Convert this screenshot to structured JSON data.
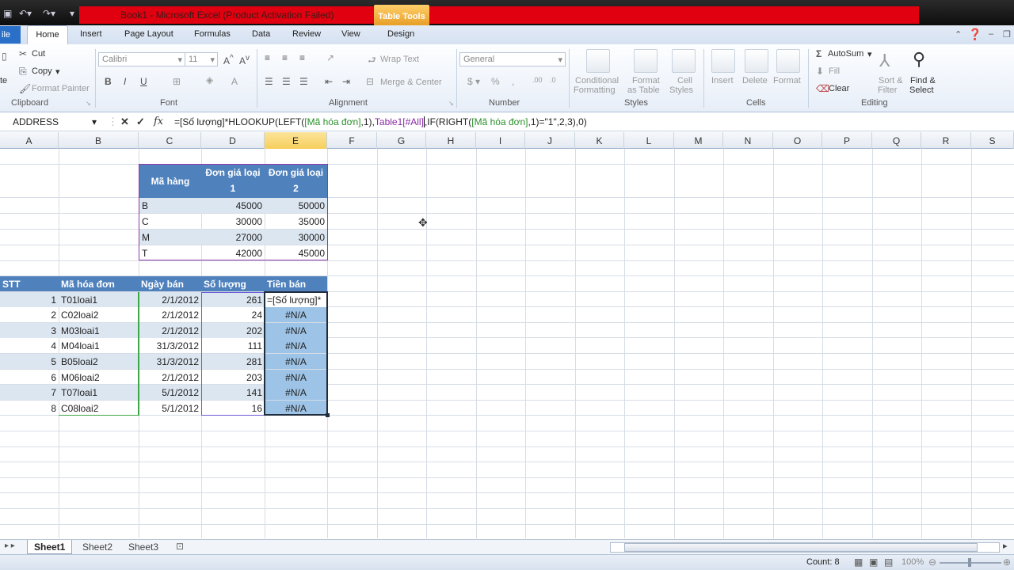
{
  "window": {
    "title": "Book1  -  Microsoft Excel (Product Activation Failed)",
    "contextual_tab_group": "Table Tools"
  },
  "ribbon_tabs": {
    "file": "ile",
    "home": "Home",
    "insert": "Insert",
    "page_layout": "Page Layout",
    "formulas": "Formulas",
    "data": "Data",
    "review": "Review",
    "view": "View",
    "design": "Design"
  },
  "clipboard": {
    "paste": "te",
    "cut": "Cut",
    "copy": "Copy",
    "format_painter": "Format Painter",
    "label": "Clipboard"
  },
  "font": {
    "name": "Calibri",
    "size": "11",
    "label": "Font"
  },
  "alignment": {
    "wrap_text": "Wrap Text",
    "merge_center": "Merge & Center",
    "label": "Alignment"
  },
  "number": {
    "format": "General",
    "label": "Number"
  },
  "styles": {
    "conditional_1": "Conditional",
    "conditional_2": "Formatting",
    "format_table_1": "Format",
    "format_table_2": "as Table",
    "cell_styles_1": "Cell",
    "cell_styles_2": "Styles",
    "label": "Styles"
  },
  "cells": {
    "insert": "Insert",
    "delete": "Delete",
    "format": "Format",
    "label": "Cells"
  },
  "editing": {
    "autosum": "AutoSum",
    "fill": "Fill",
    "clear": "Clear",
    "sort_1": "Sort &",
    "sort_2": "Filter",
    "find_1": "Find &",
    "find_2": "Select",
    "label": "Editing"
  },
  "formula_bar": {
    "name_box": "ADDRESS",
    "fx": "fx",
    "formula_part1": "=[Số lượng]*HLOOKUP(LEFT(",
    "formula_part2": "[Mã hóa đơn]",
    "formula_part3": ",1),",
    "formula_part4": "Table1[#All]",
    "formula_part5": ",IF(RIGHT(",
    "formula_part6": "[Mã hóa đơn]",
    "formula_part7": ",1)=\"1\",2,3),0)"
  },
  "columns": [
    "A",
    "B",
    "C",
    "D",
    "E",
    "F",
    "G",
    "H",
    "I",
    "J",
    "K",
    "L",
    "M",
    "N",
    "O",
    "P",
    "Q",
    "R",
    "S"
  ],
  "price_table": {
    "headers": [
      "Mã hàng",
      "Đơn giá loại",
      "1",
      "Đơn giá loại",
      "2"
    ],
    "rows": [
      [
        "B",
        "45000",
        "50000"
      ],
      [
        "C",
        "30000",
        "35000"
      ],
      [
        "M",
        "27000",
        "30000"
      ],
      [
        "T",
        "42000",
        "45000"
      ]
    ]
  },
  "sales_table": {
    "headers": [
      "STT",
      "Mã hóa đơn",
      "Ngày bán",
      "Số lượng",
      "Tiền bán"
    ],
    "rows": [
      [
        "1",
        "T01loai1",
        "2/1/2012",
        "261",
        "=[Số lượng]*"
      ],
      [
        "2",
        "C02loai2",
        "2/1/2012",
        "24",
        "#N/A"
      ],
      [
        "3",
        "M03loai1",
        "2/1/2012",
        "202",
        "#N/A"
      ],
      [
        "4",
        "M04loai1",
        "31/3/2012",
        "111",
        "#N/A"
      ],
      [
        "5",
        "B05loai2",
        "31/3/2012",
        "281",
        "#N/A"
      ],
      [
        "6",
        "M06loai2",
        "2/1/2012",
        "203",
        "#N/A"
      ],
      [
        "7",
        "T07loai1",
        "5/1/2012",
        "141",
        "#N/A"
      ],
      [
        "8",
        "C08loai2",
        "5/1/2012",
        "16",
        "#N/A"
      ]
    ]
  },
  "sheets": [
    "Sheet1",
    "Sheet2",
    "Sheet3"
  ],
  "status": {
    "count": "Count: 8",
    "zoom": "100%"
  }
}
